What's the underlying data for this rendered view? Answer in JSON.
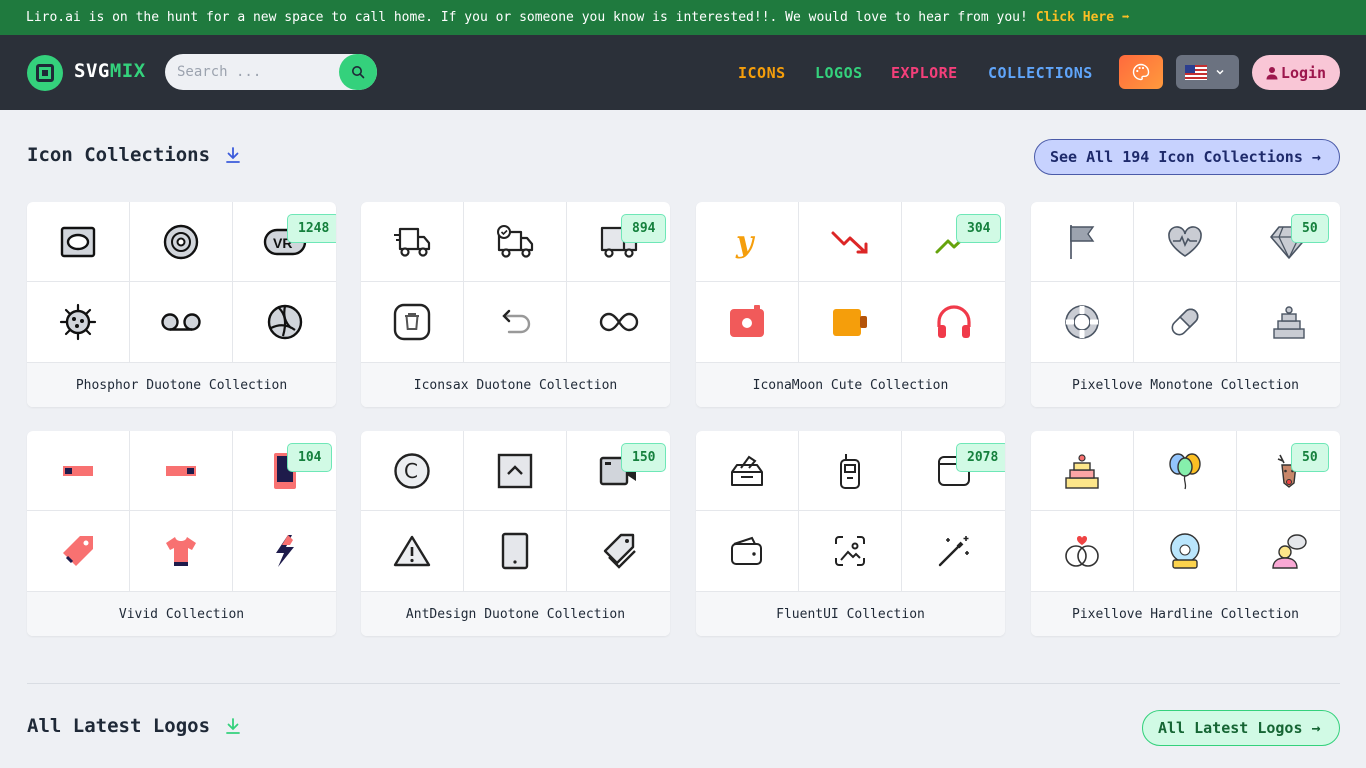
{
  "banner": {
    "message": "Liro.ai is on the hunt for a new space to call home. If you or someone you know is interested!!. We would love to hear from you!",
    "cta": "Click Here ➡"
  },
  "header": {
    "brand_part1": "SVG",
    "brand_part2": "MIX",
    "search_placeholder": "Search ...",
    "nav": [
      {
        "label": "ICONS",
        "color": "#f59e0b"
      },
      {
        "label": "LOGOS",
        "color": "#34d17c"
      },
      {
        "label": "EXPLORE",
        "color": "#f43f7a"
      },
      {
        "label": "COLLECTIONS",
        "color": "#60a5fa"
      }
    ],
    "login_label": "Login"
  },
  "icon_collections": {
    "title": "Icon Collections",
    "see_all_label": "See All 194 Icon Collections →",
    "cards": [
      {
        "name": "Phosphor Duotone Collection",
        "count": "1248"
      },
      {
        "name": "Iconsax Duotone Collection",
        "count": "894"
      },
      {
        "name": "IconaMoon Cute Collection",
        "count": "304"
      },
      {
        "name": "Pixellove Monotone Collection",
        "count": "50"
      },
      {
        "name": "Vivid Collection",
        "count": "104"
      },
      {
        "name": "AntDesign Duotone Collection",
        "count": "150"
      },
      {
        "name": "FluentUI Collection",
        "count": "2078"
      },
      {
        "name": "Pixellove Hardline Collection",
        "count": "50"
      }
    ]
  },
  "latest_logos": {
    "title": "All Latest Logos",
    "button_label": "All Latest Logos →"
  }
}
